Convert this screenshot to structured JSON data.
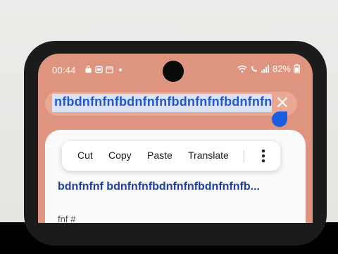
{
  "status": {
    "time": "00:44",
    "battery": "82%"
  },
  "address_bar": {
    "selected_text": "nfbdnfnfnfbdnfnfnfbdnfnfnfbdnfnfnfbdnfnfnf"
  },
  "context_menu": {
    "items": [
      "Cut",
      "Copy",
      "Paste",
      "Translate"
    ]
  },
  "result": {
    "title": "bdnfnfnf bdnfnfnfbdnfnfnfbdnfnfnfb...",
    "snippet": "fnf #"
  }
}
